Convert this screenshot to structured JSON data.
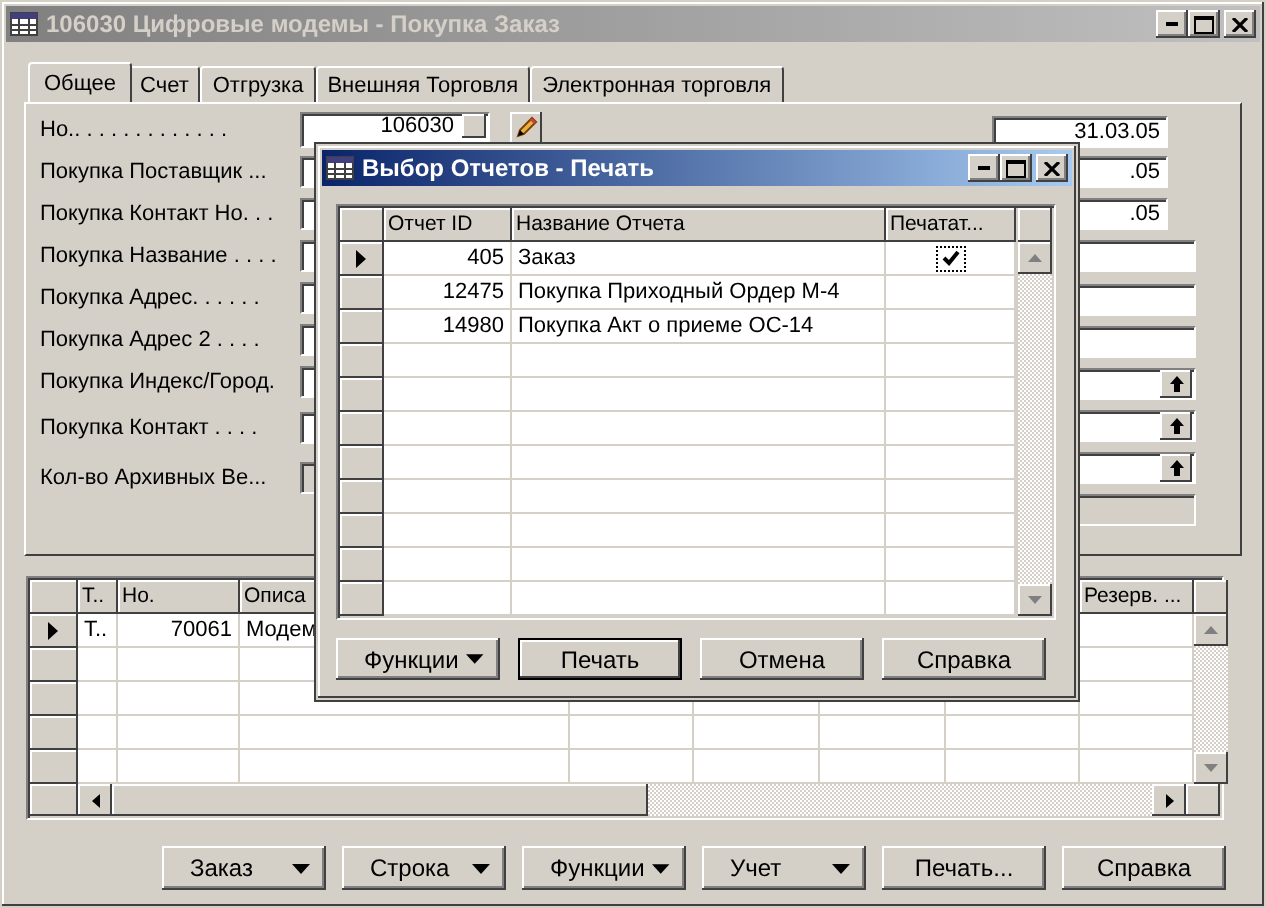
{
  "window": {
    "title": "106030 Цифровые модемы - Покупка Заказ"
  },
  "tabs": [
    {
      "label": "Общее",
      "selected": true
    },
    {
      "label": "Счет",
      "selected": false
    },
    {
      "label": "Отгрузка",
      "selected": false
    },
    {
      "label": "Внешняя Торговля",
      "selected": false
    },
    {
      "label": "Электронная торговля",
      "selected": false
    }
  ],
  "form": {
    "left": [
      {
        "label": "Но.. . . . . . . . . . . . .",
        "value": "106030",
        "kind": "assist"
      },
      {
        "label": "Покупка Поставщик ...",
        "kind": "text"
      },
      {
        "label": "Покупка Контакт Но. . .",
        "kind": "text"
      },
      {
        "label": "Покупка Название . . . .",
        "kind": "text"
      },
      {
        "label": "Покупка Адрес. . . . . .",
        "kind": "text"
      },
      {
        "label": "Покупка Адрес 2 . . . .",
        "kind": "text"
      },
      {
        "label": "Покупка Индекс/Город.",
        "kind": "text"
      },
      {
        "label": "Покупка Контакт . . . .",
        "kind": "text"
      },
      {
        "label": "Кол-во Архивных Ве...",
        "kind": "disabled"
      }
    ],
    "right": [
      {
        "value": "31.03.05",
        "kind": "date"
      },
      {
        "value": ".05",
        "kind": "date"
      },
      {
        "value": ".05",
        "kind": "date"
      },
      {
        "kind": "text"
      },
      {
        "kind": "text"
      },
      {
        "kind": "text"
      },
      {
        "kind": "lookup"
      },
      {
        "kind": "lookup"
      },
      {
        "kind": "lookup"
      },
      {
        "kind": "disabled"
      }
    ]
  },
  "lines": {
    "columns": [
      {
        "label": "Т.."
      },
      {
        "label": "Но."
      },
      {
        "label": "Описа"
      },
      {
        "label": "Резерв. ..."
      }
    ],
    "rows": [
      {
        "selected": true,
        "cells": [
          "Т..",
          "70061",
          "Модем"
        ]
      }
    ]
  },
  "buttons": [
    {
      "label": "Заказ",
      "kind": "menu"
    },
    {
      "label": "Строка",
      "kind": "menu"
    },
    {
      "label": "Функции",
      "kind": "menu"
    },
    {
      "label": "Учет",
      "kind": "menu"
    },
    {
      "label": "Печать...",
      "kind": "plain"
    },
    {
      "label": "Справка",
      "kind": "plain"
    }
  ],
  "dialog": {
    "title": "Выбор Отчетов - Печать",
    "columns": [
      {
        "label": "Отчет ID"
      },
      {
        "label": "Название Отчета"
      },
      {
        "label": "Печатат..."
      }
    ],
    "rows": [
      {
        "selected": true,
        "id": "405",
        "name": "Заказ",
        "print": true
      },
      {
        "selected": false,
        "id": "12475",
        "name": "Покупка Приходный Ордер М-4",
        "print": false
      },
      {
        "selected": false,
        "id": "14980",
        "name": "Покупка Акт о приеме ОС-14",
        "print": false
      }
    ],
    "buttons": [
      {
        "label": "Функции",
        "kind": "menu"
      },
      {
        "label": "Печать",
        "kind": "default"
      },
      {
        "label": "Отмена",
        "kind": "plain"
      },
      {
        "label": "Справка",
        "kind": "plain"
      }
    ]
  }
}
